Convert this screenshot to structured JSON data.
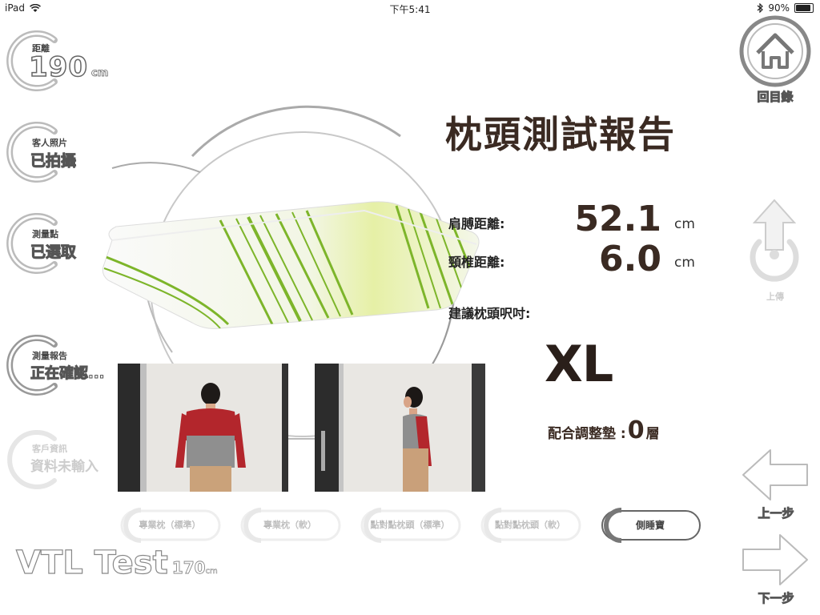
{
  "status_bar": {
    "device": "iPad",
    "time": "下午5:41",
    "battery": "90%"
  },
  "left_panel": {
    "distance": {
      "label": "距離",
      "value": "190",
      "unit": "cm"
    },
    "photo": {
      "label": "客人照片",
      "status": "已拍攝"
    },
    "point": {
      "label": "測量點",
      "status": "已選取"
    },
    "report": {
      "label": "測量報告",
      "status": "正在確認..."
    },
    "customer": {
      "label": "客戶資訊",
      "status": "資料未輸入"
    }
  },
  "nav": {
    "home_label": "回目錄",
    "upload_label": "上傳",
    "prev_label": "上一步",
    "next_label": "下一步"
  },
  "report": {
    "title": "枕頭測試報告",
    "shoulder_label": "肩膊距離:",
    "shoulder_value": "52.1",
    "shoulder_unit": "cm",
    "neck_label": "頸椎距離:",
    "neck_value": "6.0",
    "neck_unit": "cm",
    "size_label": "建議枕頭呎吋:",
    "size_value": "XL",
    "layer_label": "配合調整墊 :",
    "layer_value": "0",
    "layer_unit": "層"
  },
  "pillow_types": [
    {
      "label": "專業枕（標準）",
      "active": false
    },
    {
      "label": "專業枕（軟）",
      "active": false
    },
    {
      "label": "點對點枕頭（標準）",
      "active": false
    },
    {
      "label": "點對點枕頭（軟）",
      "active": false
    },
    {
      "label": "側睡寶",
      "active": true
    }
  ],
  "user": {
    "name": "VTL Test",
    "height": "170",
    "height_unit": "cm"
  },
  "colors": {
    "accent": "#8dc63f",
    "text_dark": "#3a2a22",
    "ring": "#bbbbbb"
  }
}
